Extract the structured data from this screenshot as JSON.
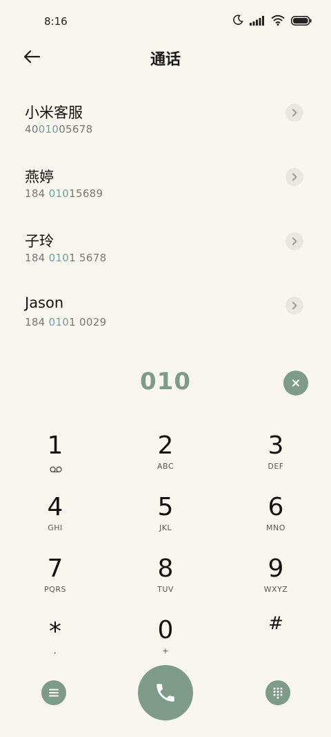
{
  "status_bar": {
    "time": "8:16",
    "icons": [
      "moon-icon",
      "signal-icon",
      "wifi-icon",
      "battery-icon"
    ]
  },
  "header": {
    "title": "通话",
    "back_icon": "arrow-left-icon"
  },
  "contacts": [
    {
      "name": "小米客服",
      "number_pre": "40",
      "number_match": "010",
      "number_post": "05678"
    },
    {
      "name": "燕婷",
      "number_pre": "184 ",
      "number_match": "010",
      "number_post": "15689"
    },
    {
      "name": "子玲",
      "number_pre": "184 ",
      "number_match": "010",
      "number_post": "1 5678"
    },
    {
      "name": "Jason",
      "number_pre": "184 ",
      "number_match": "010",
      "number_post": "1 0029"
    }
  ],
  "dial": {
    "number": "010"
  },
  "keypad": {
    "keys": [
      {
        "digit": "1",
        "letters": ""
      },
      {
        "digit": "2",
        "letters": "ABC"
      },
      {
        "digit": "3",
        "letters": "DEF"
      },
      {
        "digit": "4",
        "letters": "GHI"
      },
      {
        "digit": "5",
        "letters": "JKL"
      },
      {
        "digit": "6",
        "letters": "MNO"
      },
      {
        "digit": "7",
        "letters": "PQRS"
      },
      {
        "digit": "8",
        "letters": "TUV"
      },
      {
        "digit": "9",
        "letters": "WXYZ"
      },
      {
        "digit": "*",
        "letters": ","
      },
      {
        "digit": "0",
        "letters": "+"
      },
      {
        "digit": "#",
        "letters": ""
      }
    ]
  },
  "colors": {
    "background": "#f8f6ee",
    "accent": "#7d9b86",
    "match_highlight": "#6ea1a0"
  }
}
